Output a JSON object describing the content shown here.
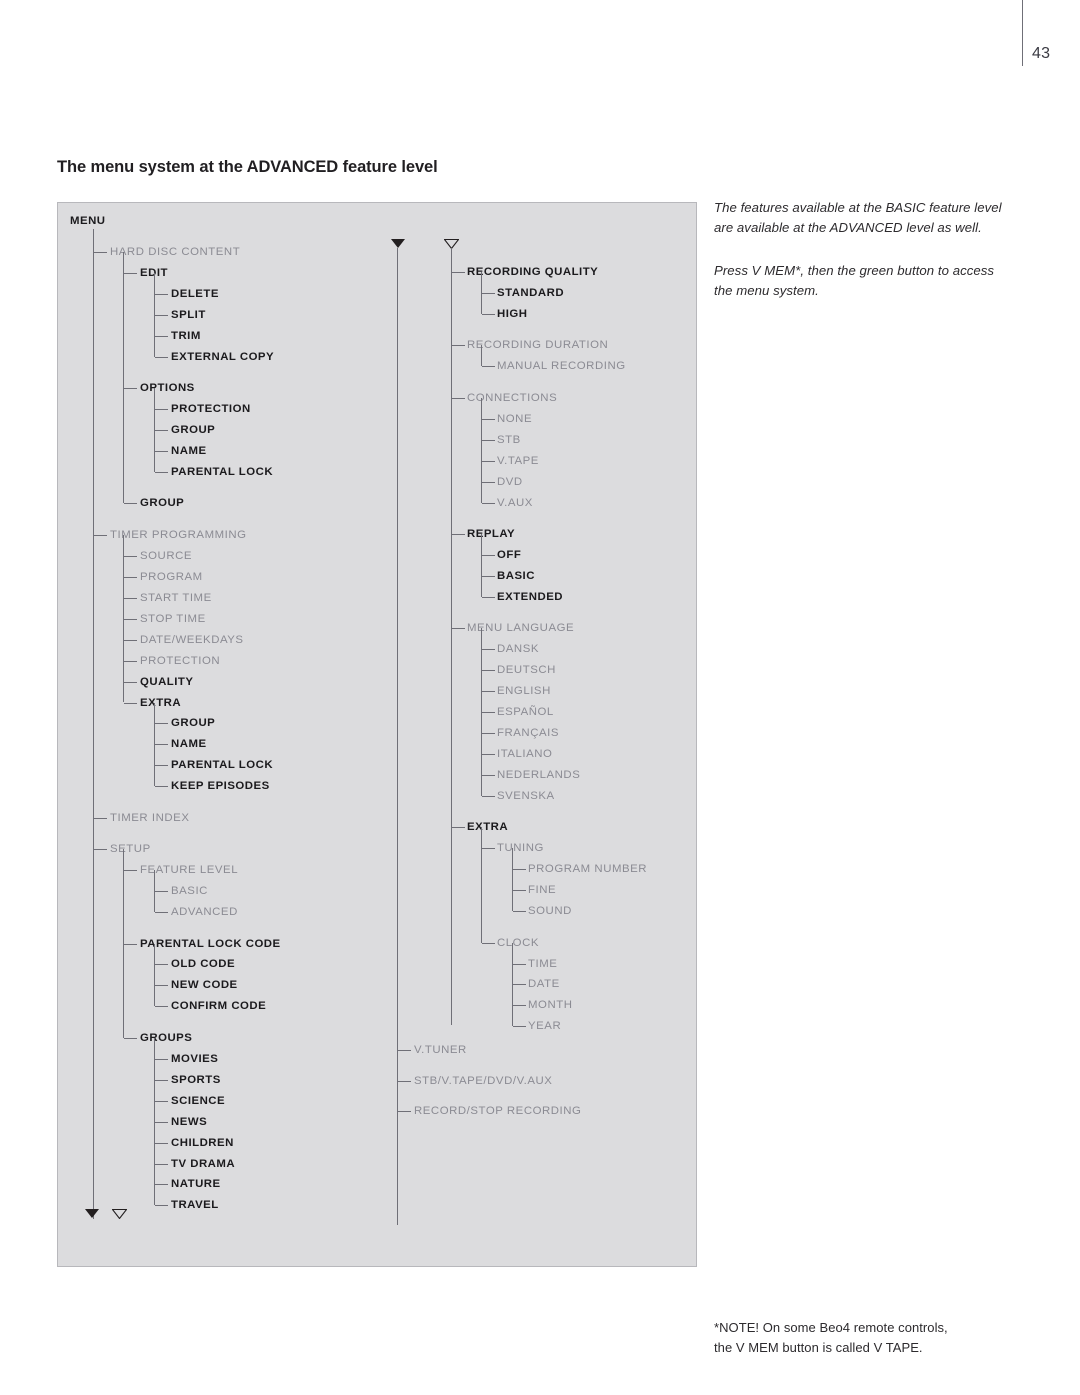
{
  "page": {
    "number": "43"
  },
  "heading": "The menu system at the ADVANCED feature level",
  "notes": {
    "paragraph1": "The features available at the BASIC feature level\nare available at the ADVANCED level as well.",
    "paragraph2": "Press V MEM*, then the green button to access\nthe menu system.",
    "footnote": "*NOTE! On some Beo4 remote controls,\n the V MEM button is called V TAPE."
  },
  "diagram": {
    "root": "MENU",
    "left_column": [
      {
        "label": "HARD DISC CONTENT",
        "level": 1,
        "style": "dim"
      },
      {
        "label": "EDIT",
        "level": 2,
        "style": "dark"
      },
      {
        "label": "DELETE",
        "level": 3,
        "style": "dark"
      },
      {
        "label": "SPLIT",
        "level": 3,
        "style": "dark"
      },
      {
        "label": "TRIM",
        "level": 3,
        "style": "dark"
      },
      {
        "label": "EXTERNAL COPY",
        "level": 3,
        "style": "dark"
      },
      {
        "label": "OPTIONS",
        "level": 2,
        "style": "dark"
      },
      {
        "label": "PROTECTION",
        "level": 3,
        "style": "dark"
      },
      {
        "label": "GROUP",
        "level": 3,
        "style": "dark"
      },
      {
        "label": "NAME",
        "level": 3,
        "style": "dark"
      },
      {
        "label": "PARENTAL LOCK",
        "level": 3,
        "style": "dark"
      },
      {
        "label": "GROUP",
        "level": 2,
        "style": "dark"
      },
      {
        "label": "TIMER PROGRAMMING",
        "level": 1,
        "style": "dim"
      },
      {
        "label": "SOURCE",
        "level": 2,
        "style": "dim"
      },
      {
        "label": "PROGRAM",
        "level": 2,
        "style": "dim"
      },
      {
        "label": "START TIME",
        "level": 2,
        "style": "dim"
      },
      {
        "label": "STOP TIME",
        "level": 2,
        "style": "dim"
      },
      {
        "label": "DATE/WEEKDAYS",
        "level": 2,
        "style": "dim"
      },
      {
        "label": "PROTECTION",
        "level": 2,
        "style": "dim"
      },
      {
        "label": "QUALITY",
        "level": 2,
        "style": "dark"
      },
      {
        "label": "EXTRA",
        "level": 2,
        "style": "dark"
      },
      {
        "label": "GROUP",
        "level": 3,
        "style": "dark"
      },
      {
        "label": "NAME",
        "level": 3,
        "style": "dark"
      },
      {
        "label": "PARENTAL LOCK",
        "level": 3,
        "style": "dark"
      },
      {
        "label": "KEEP EPISODES",
        "level": 3,
        "style": "dark"
      },
      {
        "label": "TIMER INDEX",
        "level": 1,
        "style": "dim"
      },
      {
        "label": "SETUP",
        "level": 1,
        "style": "dim"
      },
      {
        "label": "FEATURE LEVEL",
        "level": 2,
        "style": "dim"
      },
      {
        "label": "BASIC",
        "level": 3,
        "style": "dim"
      },
      {
        "label": "ADVANCED",
        "level": 3,
        "style": "dim"
      },
      {
        "label": "PARENTAL LOCK CODE",
        "level": 2,
        "style": "dark"
      },
      {
        "label": "OLD CODE",
        "level": 3,
        "style": "dark"
      },
      {
        "label": "NEW CODE",
        "level": 3,
        "style": "dark"
      },
      {
        "label": "CONFIRM CODE",
        "level": 3,
        "style": "dark"
      },
      {
        "label": "GROUPS",
        "level": 2,
        "style": "dark"
      },
      {
        "label": "MOVIES",
        "level": 3,
        "style": "dark"
      },
      {
        "label": "SPORTS",
        "level": 3,
        "style": "dark"
      },
      {
        "label": "SCIENCE",
        "level": 3,
        "style": "dark"
      },
      {
        "label": "NEWS",
        "level": 3,
        "style": "dark"
      },
      {
        "label": "CHILDREN",
        "level": 3,
        "style": "dark"
      },
      {
        "label": "TV DRAMA",
        "level": 3,
        "style": "dark"
      },
      {
        "label": "NATURE",
        "level": 3,
        "style": "dark"
      },
      {
        "label": "TRAVEL",
        "level": 3,
        "style": "dark"
      }
    ],
    "right_column": [
      {
        "label": "RECORDING QUALITY",
        "level": 1,
        "style": "dark"
      },
      {
        "label": "STANDARD",
        "level": 2,
        "style": "dark"
      },
      {
        "label": "HIGH",
        "level": 2,
        "style": "dark"
      },
      {
        "label": "RECORDING DURATION",
        "level": 1,
        "style": "dim"
      },
      {
        "label": "MANUAL RECORDING",
        "level": 2,
        "style": "dim"
      },
      {
        "label": "CONNECTIONS",
        "level": 1,
        "style": "dim"
      },
      {
        "label": "NONE",
        "level": 2,
        "style": "dim"
      },
      {
        "label": "STB",
        "level": 2,
        "style": "dim"
      },
      {
        "label": "V.TAPE",
        "level": 2,
        "style": "dim"
      },
      {
        "label": "DVD",
        "level": 2,
        "style": "dim"
      },
      {
        "label": "V.AUX",
        "level": 2,
        "style": "dim"
      },
      {
        "label": "REPLAY",
        "level": 1,
        "style": "dark"
      },
      {
        "label": "OFF",
        "level": 2,
        "style": "dark"
      },
      {
        "label": "BASIC",
        "level": 2,
        "style": "dark"
      },
      {
        "label": "EXTENDED",
        "level": 2,
        "style": "dark"
      },
      {
        "label": "MENU LANGUAGE",
        "level": 1,
        "style": "dim"
      },
      {
        "label": "DANSK",
        "level": 2,
        "style": "dim"
      },
      {
        "label": "DEUTSCH",
        "level": 2,
        "style": "dim"
      },
      {
        "label": "ENGLISH",
        "level": 2,
        "style": "dim"
      },
      {
        "label": "ESPAÑOL",
        "level": 2,
        "style": "dim"
      },
      {
        "label": "FRANÇAIS",
        "level": 2,
        "style": "dim"
      },
      {
        "label": "ITALIANO",
        "level": 2,
        "style": "dim"
      },
      {
        "label": "NEDERLANDS",
        "level": 2,
        "style": "dim"
      },
      {
        "label": "SVENSKA",
        "level": 2,
        "style": "dim"
      },
      {
        "label": "EXTRA",
        "level": 1,
        "style": "dark"
      },
      {
        "label": "TUNING",
        "level": 2,
        "style": "dim"
      },
      {
        "label": "PROGRAM NUMBER",
        "level": 3,
        "style": "dim"
      },
      {
        "label": "FINE",
        "level": 3,
        "style": "dim"
      },
      {
        "label": "SOUND",
        "level": 3,
        "style": "dim"
      },
      {
        "label": "CLOCK",
        "level": 2,
        "style": "dim"
      },
      {
        "label": "TIME",
        "level": 3,
        "style": "dim"
      },
      {
        "label": "DATE",
        "level": 3,
        "style": "dim"
      },
      {
        "label": "MONTH",
        "level": 3,
        "style": "dim"
      },
      {
        "label": "YEAR",
        "level": 3,
        "style": "dim"
      }
    ],
    "bottom_items": [
      {
        "label": "V.TUNER",
        "style": "dim"
      },
      {
        "label": "STB/V.TAPE/DVD/V.AUX",
        "style": "dim"
      },
      {
        "label": "RECORD/STOP RECORDING",
        "style": "dim"
      }
    ],
    "connector_arrows": {
      "top_filled": "arrow-down-filled-icon",
      "top_open": "arrow-down-open-icon",
      "bottom_filled": "arrow-down-filled-icon",
      "bottom_open": "arrow-down-open-icon"
    },
    "colors": {
      "panel_bg": "#dcdcde",
      "panel_border": "#b8b8bc",
      "text_dark": "#231f20",
      "text_dim": "#8b8b93",
      "connector": "#6f6f77"
    }
  }
}
